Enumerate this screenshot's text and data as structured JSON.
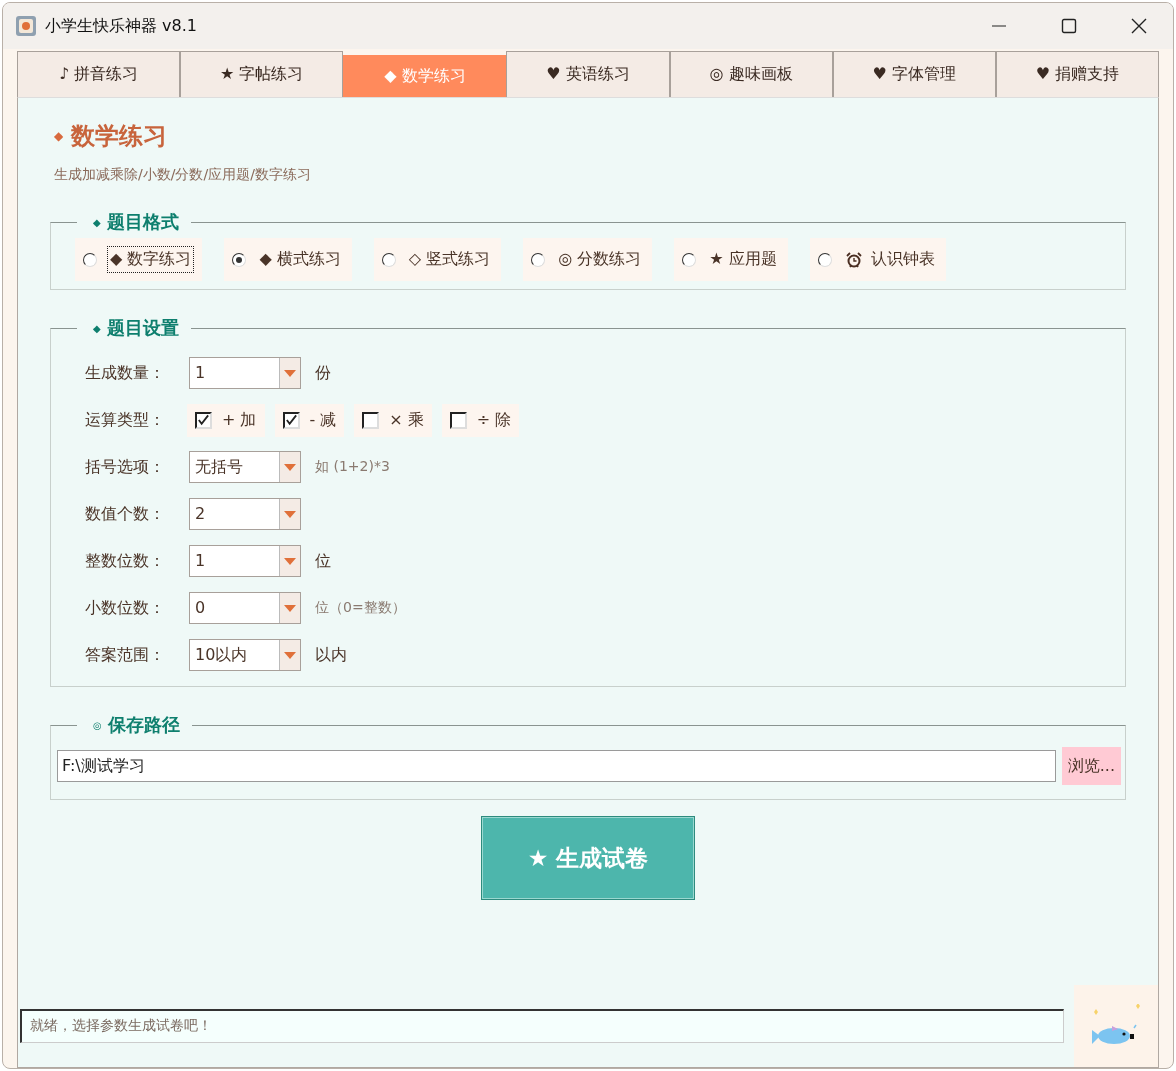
{
  "window": {
    "title": "小学生快乐神器 v8.1"
  },
  "tabs": [
    {
      "label": "♪ 拼音练习",
      "selected": false
    },
    {
      "label": "★ 字帖练习",
      "selected": false
    },
    {
      "label": "◆ 数学练习",
      "selected": true
    },
    {
      "label": "♥ 英语练习",
      "selected": false
    },
    {
      "label": "◎ 趣味画板",
      "selected": false
    },
    {
      "label": "♥ 字体管理",
      "selected": false
    },
    {
      "label": "♥ 捐赠支持",
      "selected": false
    }
  ],
  "heading": {
    "mark": "◆",
    "title": "数学练习",
    "subtitle": "生成加减乘除/小数/分数/应用题/数字练习"
  },
  "format_group": {
    "mark": "◆",
    "title": "题目格式",
    "options": [
      {
        "kind": "text",
        "label": "◆ 数字练习",
        "selected": false,
        "focused": true
      },
      {
        "kind": "text",
        "label": "◆ 横式练习",
        "selected": true,
        "focused": false
      },
      {
        "kind": "text",
        "label": "◇ 竖式练习",
        "selected": false,
        "focused": false
      },
      {
        "kind": "text",
        "label": "◎ 分数练习",
        "selected": false,
        "focused": false
      },
      {
        "kind": "text",
        "label": "★ 应用题",
        "selected": false,
        "focused": false
      },
      {
        "kind": "clock",
        "label": "认识钟表",
        "selected": false,
        "focused": false
      }
    ]
  },
  "settings_group": {
    "mark": "◆",
    "title": "题目设置",
    "rows": [
      {
        "kind": "select",
        "label": "生成数量：",
        "value": "1",
        "unit": "份"
      },
      {
        "kind": "checks",
        "label": "运算类型：",
        "options": [
          {
            "label": "+ 加",
            "checked": true
          },
          {
            "label": "- 减",
            "checked": true
          },
          {
            "label": "× 乘",
            "checked": false
          },
          {
            "label": "÷ 除",
            "checked": false
          }
        ]
      },
      {
        "kind": "select",
        "label": "括号选项：",
        "value": "无括号",
        "hint": "如 (1+2)*3"
      },
      {
        "kind": "select",
        "label": "数值个数：",
        "value": "2"
      },
      {
        "kind": "select",
        "label": "整数位数：",
        "value": "1",
        "unit": "位"
      },
      {
        "kind": "select",
        "label": "小数位数：",
        "value": "0",
        "hint": "位（0=整数）"
      },
      {
        "kind": "select",
        "label": "答案范围：",
        "value": "10以内",
        "unit": "以内"
      }
    ]
  },
  "save_group": {
    "mark": "◎",
    "title": "保存路径",
    "path": "F:\\测试学习",
    "browse_button": "浏览..."
  },
  "generate_button": "★ 生成试卷",
  "status_bar": {
    "text": "就绪，选择参数生成试卷吧！"
  }
}
